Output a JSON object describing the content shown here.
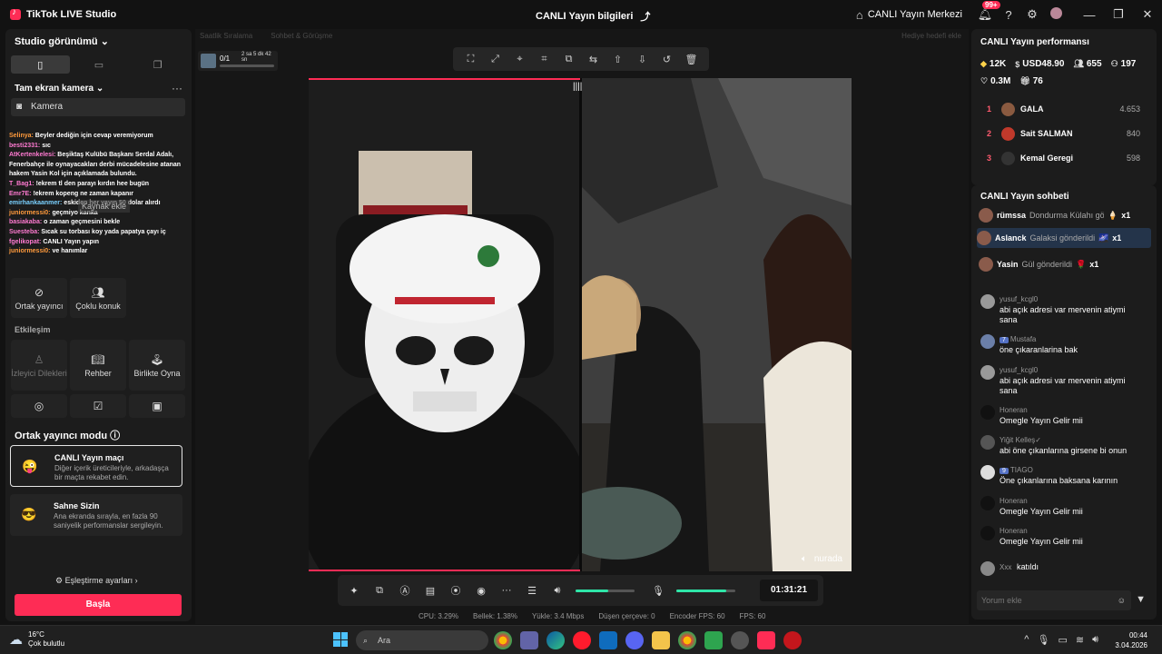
{
  "titlebar": {
    "app_name": "TikTok LIVE Studio",
    "live_info": "CANLI Yayın bilgileri",
    "live_center": "CANLI Yayın Merkezi",
    "notif_badge": "99+"
  },
  "left": {
    "studio_view": "Studio görünümü",
    "scene_name": "Tam ekran kamera",
    "source_label": "Kamera",
    "add_source": "Kaynak ekle",
    "chat_lines": [
      {
        "user": "Selinya:",
        "text": " Beyler dediğin için cevap veremiyorum",
        "cls": "u3"
      },
      {
        "user": "besti2331:",
        "text": " sıc",
        "cls": "u"
      },
      {
        "user": "AtKertenkelesi:",
        "text": " Beşiktaş Kulübü Başkanı Serdal Adalı, Fenerbahçe ile oynayacakları derbi mücadelesine atanan hakem Yasin Kol için açıklamada bulundu.",
        "cls": "u"
      },
      {
        "user": "T_Bag1:",
        "text": " !ekrem tl den parayı kırdın hee bugün",
        "cls": "u"
      },
      {
        "user": "Emr7E:",
        "text": " !ekrem kopeng ne zaman kapanır",
        "cls": "u"
      },
      {
        "user": "emirhankaanmer:",
        "text": " eskiden her yayın 50 dolar alırdı",
        "cls": "u2"
      },
      {
        "user": "juniormessi0:",
        "text": " geçmiyo kanka",
        "cls": "u3"
      },
      {
        "user": "basiakaba:",
        "text": " o zaman geçmesini bekle",
        "cls": "u"
      },
      {
        "user": "Suesteba:",
        "text": " Sıcak su torbası koy yada papatya çayı iç",
        "cls": "u"
      },
      {
        "user": "fgelikopat:",
        "text": " CANLI Yayın yapın",
        "cls": "u"
      },
      {
        "user": "juniormessi0:",
        "text": " ve hanımlar",
        "cls": "u3"
      }
    ],
    "tools": {
      "cohost": "Ortak yayıncı",
      "multi_guest": "Çoklu konuk",
      "interaction": "Etkileşim",
      "viewer_wishes": "İzleyici Dilekleri",
      "guide": "Rehber",
      "play_together": "Birlikte Oyna"
    },
    "cohost_mode": {
      "title": "Ortak yayıncı modu",
      "cards": [
        {
          "name": "CANLI Yayın maçı",
          "desc": "Diğer içerik üreticileriyle, arkadaşça bir maçta rekabet edin."
        },
        {
          "name": "Sahne Sizin",
          "desc": "Ana ekranda sırayla, en fazla 90 saniyelik performanslar sergileyin."
        }
      ],
      "match_settings": "Eşleştirme ayarları",
      "start": "Başla"
    }
  },
  "center": {
    "tabs": [
      "Saatlik Sıralama",
      "Sohbet & Görüşme"
    ],
    "tab_right": "Hediye hedefi ekle",
    "goal_count": "0/1",
    "goal_time": "2 sa 5 dk 42 sn",
    "nurada": "nurada",
    "timer": "01:31:21",
    "volume": 0.55,
    "mic_volume": 0.85,
    "stats": {
      "cpu": "CPU: 3.29%",
      "mem": "Bellek: 1.38%",
      "upload": "Yükle: 3.4 Mbps",
      "dropped": "Düşen çerçeve: 0",
      "enc_fps": "Encoder FPS: 60",
      "fps": "FPS: 60"
    }
  },
  "right": {
    "perf_title": "CANLI Yayın performansı",
    "metrics": {
      "diamonds": "12K",
      "usd": "USD48.90",
      "viewers": "655",
      "followers": "197",
      "likes": "0.3M",
      "gifts": "76"
    },
    "gifters": [
      {
        "rank": "1",
        "name": "GALA",
        "value": "4.653"
      },
      {
        "rank": "2",
        "name": "Sait SALMAN",
        "value": "840"
      },
      {
        "rank": "3",
        "name": "Kemal Geregi",
        "value": "598"
      }
    ],
    "chat_title": "CANLI Yayın sohbeti",
    "gift_msgs": [
      {
        "user": "rümssa",
        "act": "Dondurma Külahı gönd",
        "x": "x1"
      },
      {
        "user": "Aslanck",
        "act": "Galaksi gönderildi",
        "x": "x1"
      },
      {
        "user": "Yasin",
        "act": "Gül gönderildi",
        "x": "x1"
      }
    ],
    "comments": [
      {
        "user": "yusuf_kcgl0",
        "text": "abi açık adresi var mervenin atiymi sana",
        "lvl": ""
      },
      {
        "user": "Mustafa",
        "text": "öne çıkaranlarina bak",
        "lvl": "7"
      },
      {
        "user": "yusuf_kcgl0",
        "text": "abi açık adresi var mervenin atiymi sana",
        "lvl": ""
      },
      {
        "user": "Honeran",
        "text": "Omegle Yayın Gelir mii",
        "lvl": ""
      },
      {
        "user": "Yiğit Kelleş✓",
        "text": "abi öne çıkanlarına girsene bi onun",
        "lvl": ""
      },
      {
        "user": "TIAGO",
        "text": "Öne çıkanlarına baksana karının",
        "lvl": "9"
      },
      {
        "user": "Honeran",
        "text": "Omegle Yayın Gelir mii",
        "lvl": ""
      },
      {
        "user": "Honeran",
        "text": "Omegle Yayın Gelir mii",
        "lvl": ""
      }
    ],
    "joined_user": "Xxx",
    "joined_text": "katıldı",
    "comment_placeholder": "Yorum ekle"
  },
  "taskbar": {
    "temp": "16°C",
    "weather": "Çok bulutlu",
    "search": "Ara",
    "time": "00:44",
    "date": "3.04.2026"
  }
}
